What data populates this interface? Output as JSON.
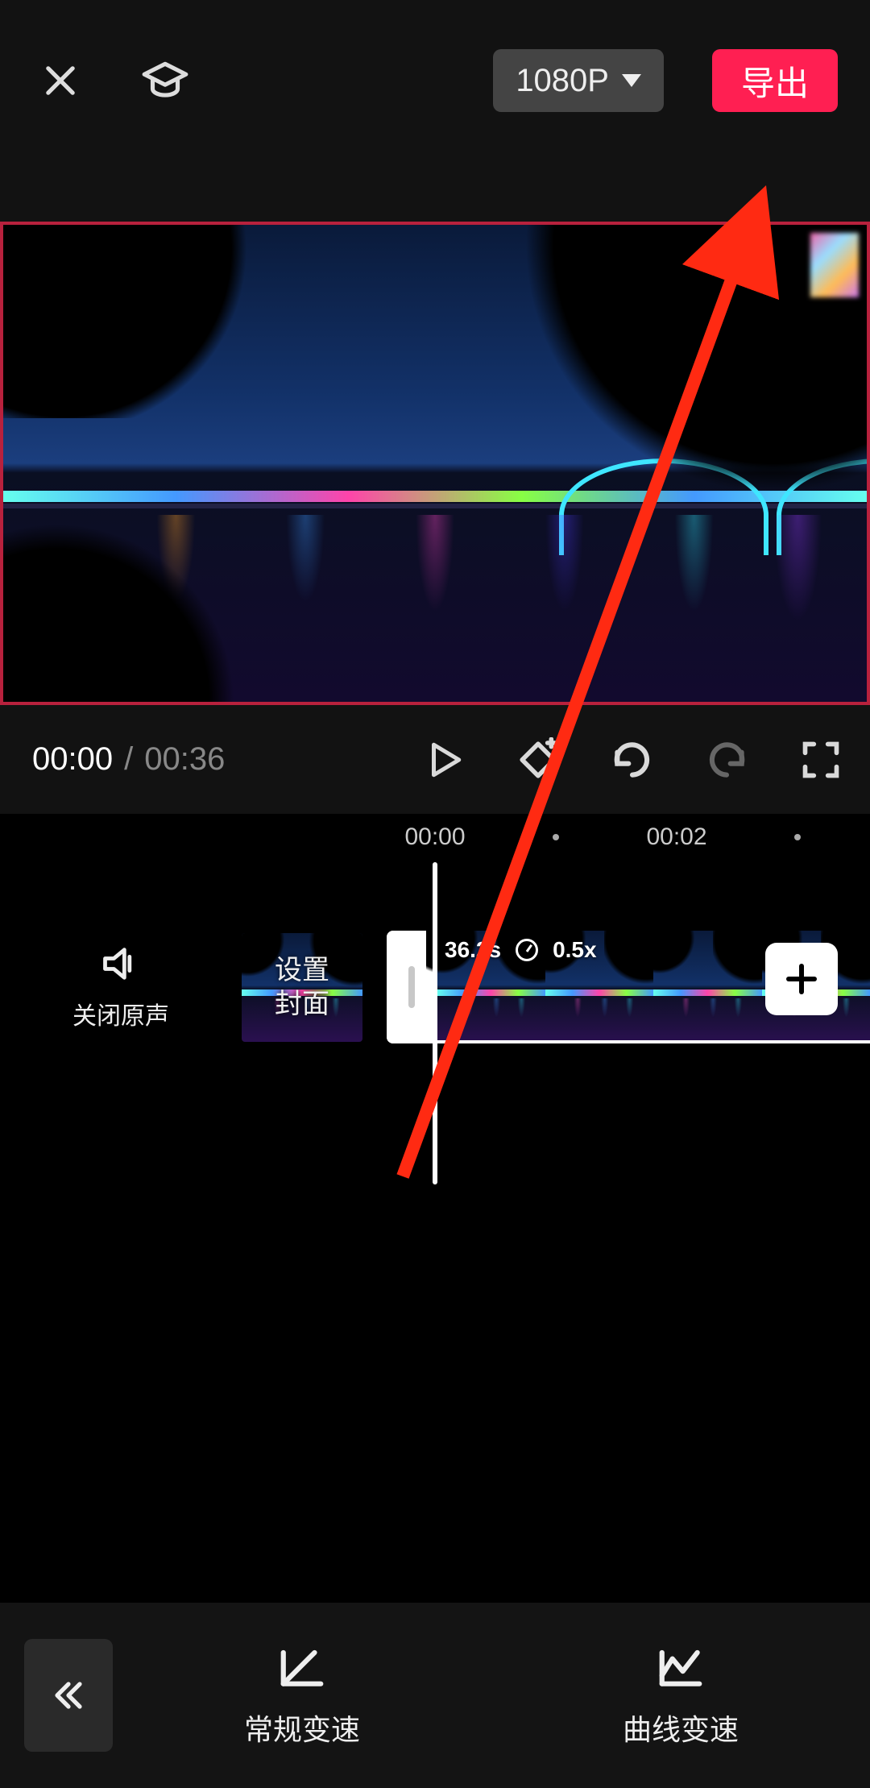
{
  "topbar": {
    "resolution_label": "1080P",
    "export_label": "导出"
  },
  "playback": {
    "current_time": "00:00",
    "separator": "/",
    "total_time": "00:36"
  },
  "ruler": {
    "tick0": "00:00",
    "tick1": "00:02"
  },
  "audio": {
    "mute_label": "关闭原声"
  },
  "cover": {
    "label": "设置\n封面"
  },
  "clip": {
    "duration_label": "36.2s",
    "speed_label": "0.5x"
  },
  "bottom": {
    "normal_speed_label": "常规变速",
    "curve_speed_label": "曲线变速"
  },
  "icons": {
    "close": "close-icon",
    "graduation": "tutorial-icon",
    "play": "play-icon",
    "keyframe": "add-keyframe-icon",
    "undo": "undo-icon",
    "redo": "redo-icon",
    "fullscreen": "fullscreen-icon",
    "speaker": "speaker-icon",
    "plus": "plus-icon",
    "chevrons": "back-chevrons-icon",
    "normal_speed": "normal-speed-icon",
    "curve_speed": "curve-speed-icon"
  },
  "colors": {
    "accent": "#ff1f52",
    "annotation": "#ff2a12"
  }
}
